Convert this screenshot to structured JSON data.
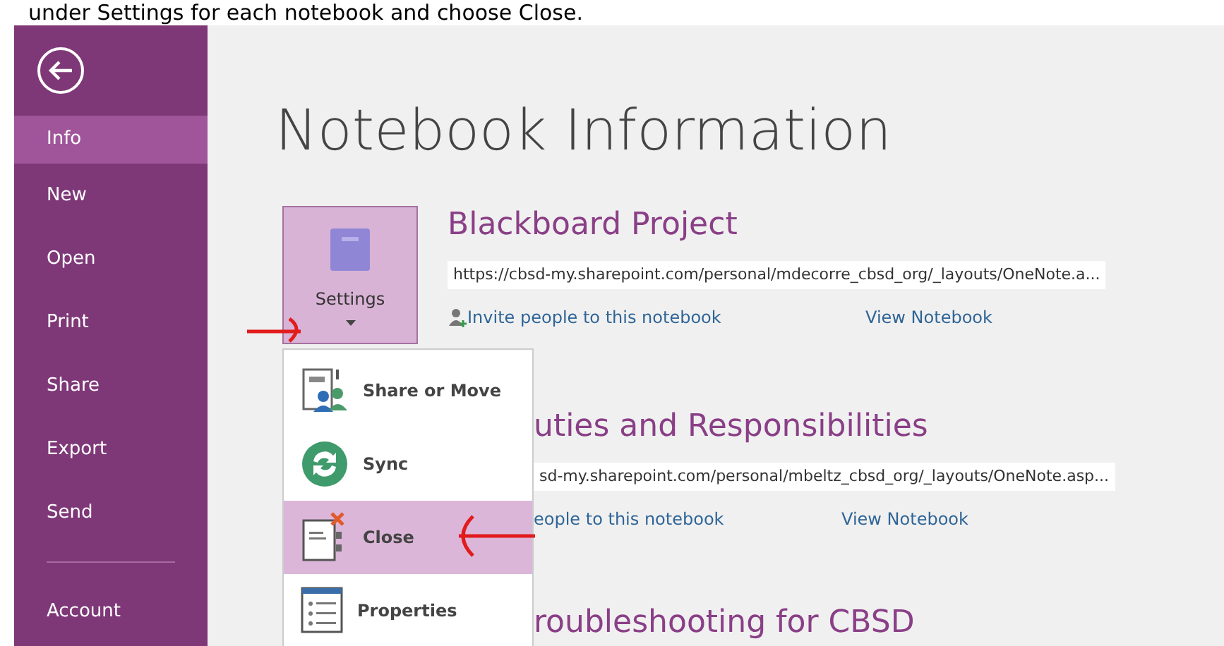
{
  "caption": "under Settings for each notebook and choose Close.",
  "sidebar": {
    "items": [
      {
        "label": "Info",
        "selected": true
      },
      {
        "label": "New",
        "selected": false
      },
      {
        "label": "Open",
        "selected": false
      },
      {
        "label": "Print",
        "selected": false
      },
      {
        "label": "Share",
        "selected": false
      },
      {
        "label": "Export",
        "selected": false
      },
      {
        "label": "Send",
        "selected": false
      }
    ],
    "footer_items": [
      {
        "label": "Account",
        "selected": false
      }
    ]
  },
  "page_title": "Notebook Information",
  "settings_button": {
    "label": "Settings"
  },
  "settings_menu": {
    "items": [
      {
        "label": "Share or Move",
        "kind": "share",
        "selected": false
      },
      {
        "label": "Sync",
        "kind": "sync",
        "selected": false
      },
      {
        "label": "Close",
        "kind": "close",
        "selected": true
      },
      {
        "label": "Properties",
        "kind": "properties",
        "selected": false
      }
    ]
  },
  "notebooks": [
    {
      "title": "Blackboard Project",
      "url": "https://cbsd-my.sharepoint.com/personal/mdecorre_cbsd_org/_layouts/OneNote.a...",
      "invite_link": "Invite people to this notebook",
      "view_link": "View Notebook"
    },
    {
      "title": "uties and Responsibilities",
      "url": "sd-my.sharepoint.com/personal/mbeltz_cbsd_org/_layouts/OneNote.asp...",
      "invite_link": "eople to this notebook",
      "view_link": "View Notebook"
    },
    {
      "title": "roubleshooting for CBSD"
    }
  ]
}
